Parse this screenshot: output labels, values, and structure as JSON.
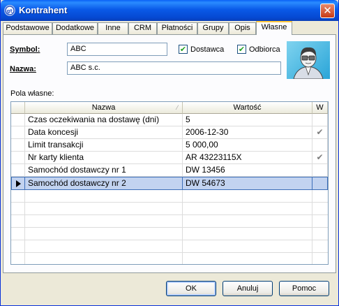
{
  "window": {
    "title": "Kontrahent",
    "icon": "gt-app-icon",
    "close_symbol": "✕"
  },
  "tabs": [
    {
      "label": "Podstawowe"
    },
    {
      "label": "Dodatkowe"
    },
    {
      "label": "Inne"
    },
    {
      "label": "CRM"
    },
    {
      "label": "Płatności"
    },
    {
      "label": "Grupy"
    },
    {
      "label": "Opis"
    },
    {
      "label": "Własne",
      "active": true
    }
  ],
  "form": {
    "symbol_label": "Symbol:",
    "symbol_value": "ABC",
    "nazwa_label": "Nazwa:",
    "nazwa_value": "ABC s.c.",
    "dostawca_label": "Dostawca",
    "dostawca_checked": true,
    "odbiorca_label": "Odbiorca",
    "odbiorca_checked": true,
    "avatar_icon": "person-avatar-icon"
  },
  "custom_fields": {
    "section_label": "Pola własne:",
    "columns": [
      "Nazwa",
      "Wartość",
      "W"
    ],
    "rows": [
      {
        "name": "Czas oczekiwania na dostawę (dni)",
        "value": "5",
        "w": ""
      },
      {
        "name": "Data koncesji",
        "value": "2006-12-30",
        "w": "✔"
      },
      {
        "name": "Limit transakcji",
        "value": "5 000,00",
        "w": ""
      },
      {
        "name": "Nr karty klienta",
        "value": "AR 43223115X",
        "w": "✔"
      },
      {
        "name": "Samochód dostawczy nr 1",
        "value": "DW 13456",
        "w": ""
      },
      {
        "name": "Samochód dostawczy nr 2",
        "value": "DW 54673",
        "w": "",
        "selected": true
      }
    ]
  },
  "buttons": {
    "ok": "OK",
    "cancel": "Anuluj",
    "help": "Pomoc"
  },
  "colors": {
    "titlebar": "#0a5ae8",
    "selection": "#c2d3f0",
    "check": "#7d7d7d"
  }
}
